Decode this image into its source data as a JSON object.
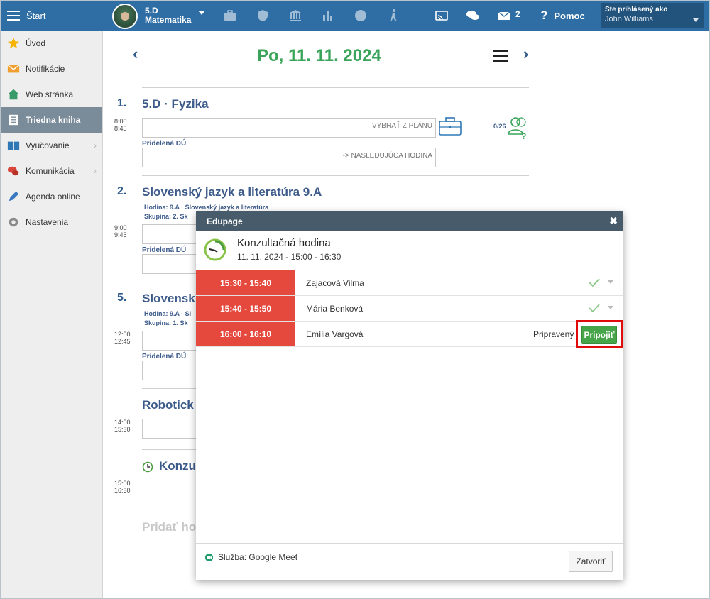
{
  "topbar": {
    "start_label": "Štart",
    "class_line1": "5.D",
    "class_line2": "Matematika",
    "mail_count": "2",
    "help_label": "Pomoc",
    "user_label": "Ste prihlásený ako",
    "user_name": "John Williams"
  },
  "sidebar": {
    "items": [
      {
        "label": "Úvod",
        "icon": "star-icon"
      },
      {
        "label": "Notifikácie",
        "icon": "envelope-icon"
      },
      {
        "label": "Web stránka",
        "icon": "house-icon"
      },
      {
        "label": "Triedna kniha",
        "icon": "notebook-icon"
      },
      {
        "label": "Vyučovanie",
        "icon": "book-icon"
      },
      {
        "label": "Komunikácia",
        "icon": "chat-icon"
      },
      {
        "label": "Agenda online",
        "icon": "pen-icon"
      },
      {
        "label": "Nastavenia",
        "icon": "gear-icon"
      }
    ]
  },
  "main": {
    "day_title": "Po, 11. 11. 2024",
    "lessons": [
      {
        "num": "1.",
        "title": "5.D · Fyzika",
        "time_start": "8:00",
        "time_end": "8:45",
        "plan_placeholder": "VYBRAŤ Z PLÁNU",
        "hw_label": "Pridelená DÚ",
        "hw_placeholder": "-> NASLEDUJÚCA HODINA",
        "attendance": "0/26"
      },
      {
        "num": "2.",
        "title": "Slovenský jazyk a literatúra  9.A",
        "meta1": "Hodina:  9.A · Slovenský jazyk a literatúra",
        "meta2": "Skupina:  2. Sk",
        "time_start": "9:00",
        "time_end": "9:45",
        "hw_label": "Pridelená DÚ"
      },
      {
        "num": "5.",
        "title": "Slovensk",
        "meta1": "Hodina:  9.A · Sl",
        "meta2": "Skupina:  1. Sk",
        "time_start": "12:00",
        "time_end": "12:45",
        "hw_label": "Pridelená DÚ"
      },
      {
        "title": "Robotick",
        "time_start": "14:00",
        "time_end": "15:30"
      },
      {
        "title": "Konzu",
        "time_start": "15:00",
        "time_end": "16:30"
      }
    ],
    "add_lesson": "Pridať ho"
  },
  "modal": {
    "header": "Edupage",
    "title": "Konzultačná hodina",
    "subtitle": "11. 11. 2024 - 15:00 - 16:30",
    "slots": [
      {
        "time": "15:30 - 15:40",
        "name": "Zajacová Vilma"
      },
      {
        "time": "15:40 - 15:50",
        "name": "Mária Benková"
      },
      {
        "time": "16:00 - 16:10",
        "name": "Emília Vargová",
        "status": "Pripravený",
        "join": "Pripojiť"
      }
    ],
    "service": "Služba: Google Meet",
    "close_label": "Zatvoriť"
  },
  "colors": {
    "topbar": "#2f6ea4",
    "slot": "#e5483c",
    "join": "#45a548",
    "date": "#3aa55a",
    "highlight": "#e10b0b"
  }
}
